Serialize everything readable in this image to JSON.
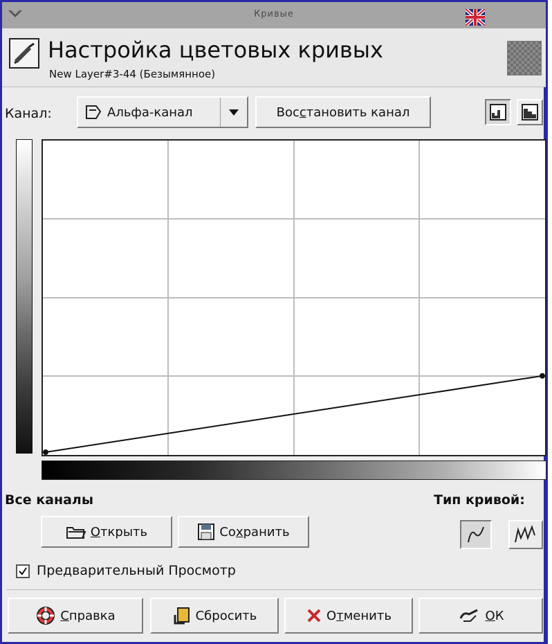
{
  "window": {
    "title": "Кривые"
  },
  "header": {
    "title": "Настройка цветовых кривых",
    "subtitle": "New Layer#3-44 (Безымянное)"
  },
  "channel": {
    "label": "Канал:",
    "selected": "Альфа-канал",
    "reset_button": {
      "pre": "Вос",
      "mnemonic": "с",
      "post": "тановить канал"
    }
  },
  "curve": {
    "start": [
      0,
      0
    ],
    "end": [
      255,
      63
    ]
  },
  "all_channels": {
    "label": "Все каналы",
    "open_button": {
      "mnemonic": "О",
      "post": "ткрыть"
    },
    "save_button": {
      "pre": "Со",
      "mnemonic": "х",
      "post": "ранить"
    }
  },
  "curve_type": {
    "label": "Тип кривой:",
    "selected": "smooth"
  },
  "preview": {
    "label": "Предварительный Просмотр",
    "checked": true
  },
  "footer": {
    "help_button": {
      "mnemonic": "С",
      "post": "правка"
    },
    "reset_button": {
      "label": "Сбросить"
    },
    "cancel_button": {
      "pre": "О",
      "mnemonic": "т",
      "post": "менить"
    },
    "ok_button": {
      "mnemonic": "О",
      "post": "К"
    }
  },
  "colors": {
    "border": "#2a2aa6",
    "titlebar": "#a5a5a5",
    "panel": "#ececec"
  }
}
